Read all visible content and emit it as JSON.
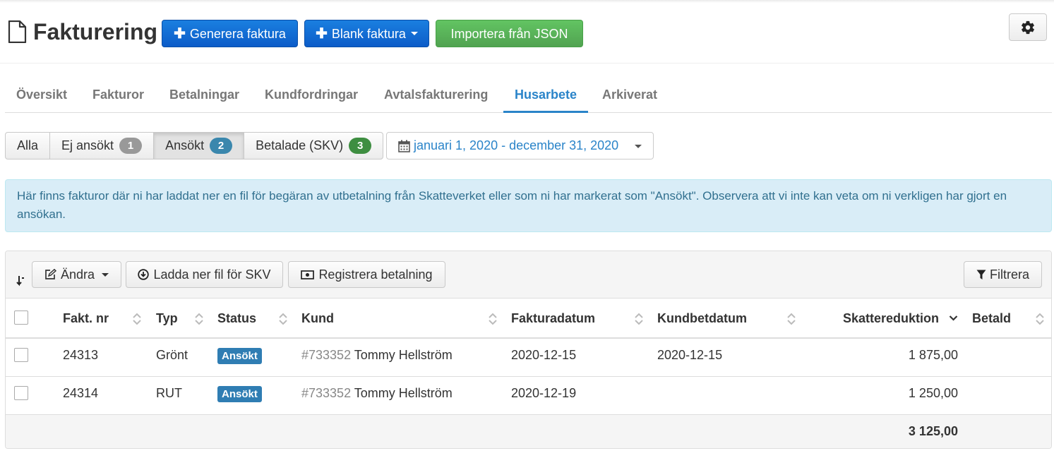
{
  "header": {
    "title": "Fakturering",
    "generate_label": "Generera faktura",
    "blank_label": "Blank faktura",
    "import_label": "Importera från JSON"
  },
  "tabs": [
    {
      "label": "Översikt"
    },
    {
      "label": "Fakturor"
    },
    {
      "label": "Betalningar"
    },
    {
      "label": "Kundfordringar"
    },
    {
      "label": "Avtalsfakturering"
    },
    {
      "label": "Husarbete",
      "active": true
    },
    {
      "label": "Arkiverat"
    }
  ],
  "filters": {
    "all_label": "Alla",
    "not_applied_label": "Ej ansökt",
    "not_applied_count": "1",
    "applied_label": "Ansökt",
    "applied_count": "2",
    "paid_label": "Betalade (SKV)",
    "paid_count": "3",
    "date_range": "januari 1, 2020 - december 31, 2020",
    "active": "Ansökt"
  },
  "alert": {
    "text": "Här finns fakturor där ni har laddat ner en fil för begäran av utbetalning från Skatteverket eller som ni har markerat som \"Ansökt\". Observera att vi inte kan veta om ni verkligen har gjort en ansökan."
  },
  "toolbar": {
    "edit_label": "Ändra",
    "download_label": "Ladda ner fil för SKV",
    "register_label": "Registrera betalning",
    "filter_label": "Filtrera"
  },
  "table": {
    "columns": {
      "invoice_no": "Fakt. nr",
      "type": "Typ",
      "status": "Status",
      "customer": "Kund",
      "invoice_date": "Fakturadatum",
      "customer_pay_date": "Kundbetdatum",
      "tax_reduction": "Skattereduktion",
      "paid": "Betald"
    },
    "rows": [
      {
        "invoice_no": "24313",
        "type": "Grönt",
        "status": "Ansökt",
        "customer_id": "#733352",
        "customer_name": "Tommy Hellström",
        "invoice_date": "2020-12-15",
        "customer_pay_date": "2020-12-15",
        "tax_reduction": "1 875,00",
        "paid": ""
      },
      {
        "invoice_no": "24314",
        "type": "RUT",
        "status": "Ansökt",
        "customer_id": "#733352",
        "customer_name": "Tommy Hellström",
        "invoice_date": "2020-12-19",
        "customer_pay_date": "",
        "tax_reduction": "1 250,00",
        "paid": ""
      }
    ],
    "total": "3 125,00"
  },
  "colors": {
    "primary": "#0c5cc8",
    "success": "#51a351",
    "link": "#2a84c9",
    "badge_gray": "#999999",
    "badge_blue": "#3a87ad",
    "badge_green": "#3e8e41",
    "status_label": "#2f7db3",
    "alert_bg": "#d9edf7"
  },
  "icons": {
    "page": "file-icon",
    "plus": "plus-icon",
    "gear": "gear-icon",
    "calendar": "calendar-icon",
    "edit": "edit-icon",
    "download": "download-circle-icon",
    "money": "money-icon",
    "filter": "filter-icon",
    "sort": "sort-icon"
  }
}
